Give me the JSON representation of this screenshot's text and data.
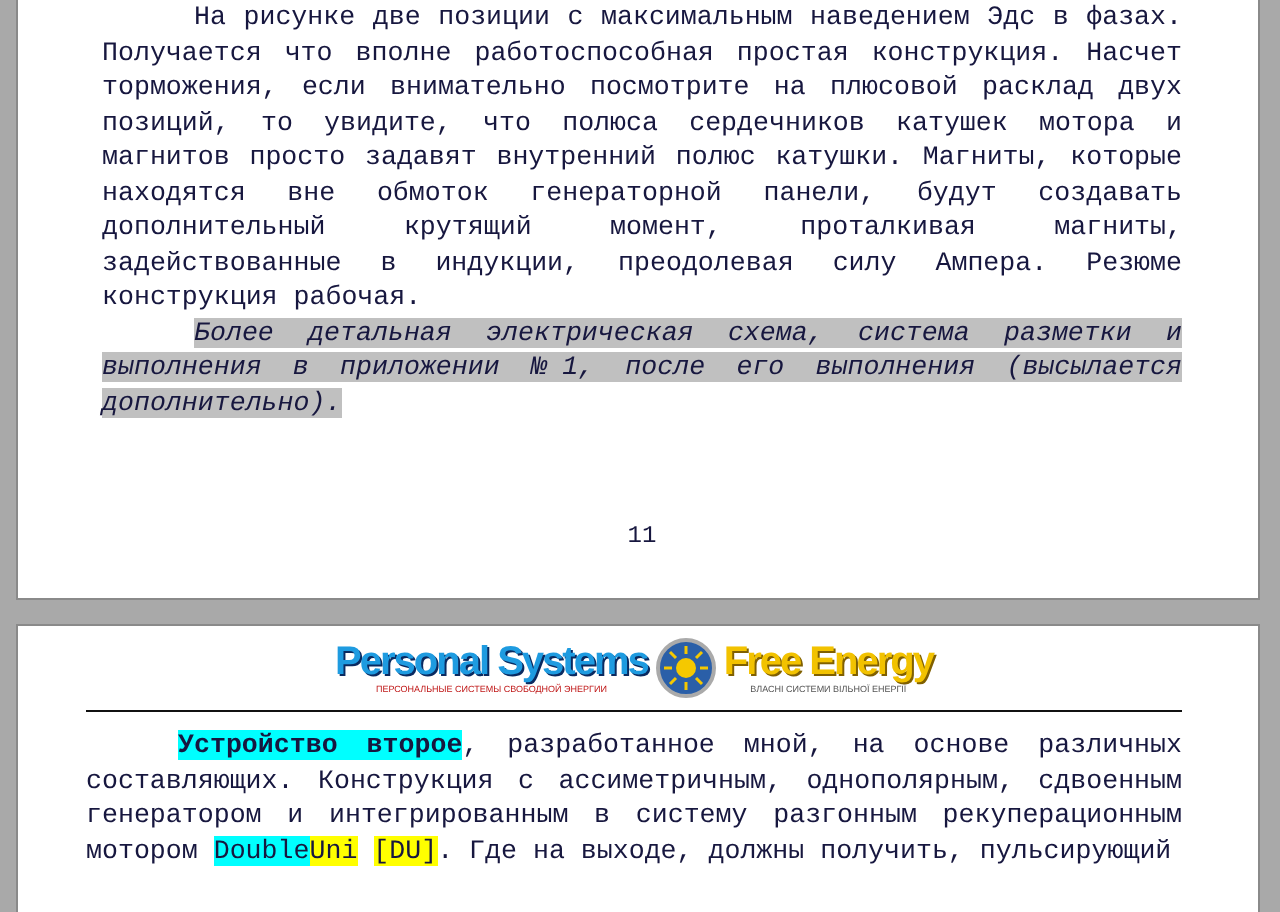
{
  "pages": [
    {
      "paragraphs": [
        {
          "kind": "body",
          "segments": [
            {
              "text": "На рисунке две позиции с максимальным наведением Эдс в фазах. Получается что вполне работоспособная простая конструкция. Насчет торможения, если внимательно посмотрите на плюсовой расклад двух позиций, то увидите, что полюса сердечников катушек мотора и магнитов просто задавят внутренний полюс катушки. Магниты, которые находятся вне обмоток генераторной панели, будут создавать дополнительный крутящий момент, проталкивая магниты, задействованные в индукции, преодолевая силу Ампера. Резюме конструкция рабочая."
            }
          ]
        },
        {
          "kind": "note",
          "segments": [
            {
              "text": "Более детальная электрическая схема, система разметки и выполнения в приложении №1, после его выполнения (высылается дополнительно)."
            }
          ]
        }
      ],
      "page_number": "11"
    },
    {
      "header": {
        "title_left": "Personal Systems",
        "subtitle_left": "ПЕРСОНАЛЬНЫЕ СИСТЕМЫ СВОБОДНОЙ ЭНЕРГИИ",
        "title_right": "Free Energy",
        "subtitle_right": "ВЛАСНІ СИСТЕМИ ВІЛЬНОЇ ЕНЕРГІЇ"
      },
      "paragraphs": [
        {
          "kind": "body",
          "segments": [
            {
              "text": "Устройство второе",
              "bold": true,
              "color": "#00ffff"
            },
            {
              "text": ", разработанное мной, на основе различных составляющих. Конструкция с ассиметричным, однополярным, сдвоенным генератором и интегрированным в систему разгонным рекуперационным мотором "
            },
            {
              "text": "Double",
              "color": "#00ffff"
            },
            {
              "text": "Uni",
              "color": "#ffff00"
            },
            {
              "text": "[DU]",
              "color": "#ffff00",
              "gap_before": true
            },
            {
              "text": ". Где на выходе, должны получить, пульсирующий"
            }
          ]
        }
      ]
    }
  ]
}
